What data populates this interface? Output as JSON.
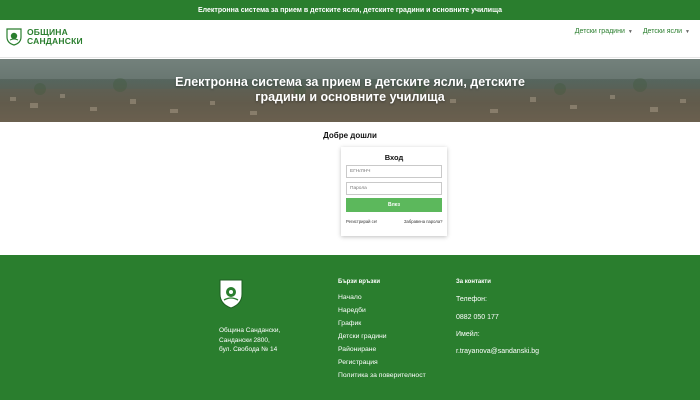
{
  "topbar": {
    "text": "Електронна система за прием в детските ясли, детските градини и основните училища"
  },
  "header": {
    "logo_line1": "ОБЩИНА",
    "logo_line2": "САНДАНСКИ",
    "nav": [
      {
        "label": "Детски градини"
      },
      {
        "label": "Детски ясли"
      }
    ]
  },
  "hero": {
    "title_line1": "Електронна система за прием в детските ясли, детските",
    "title_line2": "градини и основните училища"
  },
  "welcome": "Добре дошли",
  "login": {
    "title": "Вход",
    "email_placeholder": "ЕГН/ЛНЧ",
    "password_placeholder": "Парола",
    "submit_label": "Влез",
    "register_link": "Регистрирай се!",
    "forgot_link": "Забравена парола?"
  },
  "footer": {
    "address_line1": "Община Сандански,",
    "address_line2": "Сандански 2800,",
    "address_line3": "бул. Свобода № 14",
    "quick_links_title": "Бързи връзки",
    "quick_links": [
      "Начало",
      "Наредби",
      "График",
      "Детски градини",
      "Райониране",
      "Регистрация",
      "Политика за поверителност"
    ],
    "contacts_title": "За контакти",
    "phone_label": "Телефон:",
    "phone_value": "0882 050 177",
    "email_label": "Имейл:",
    "email_value": "r.trayanova@sandanski.bg"
  },
  "colors": {
    "brand_green": "#2a7e2e",
    "button_green": "#5cb85c"
  }
}
